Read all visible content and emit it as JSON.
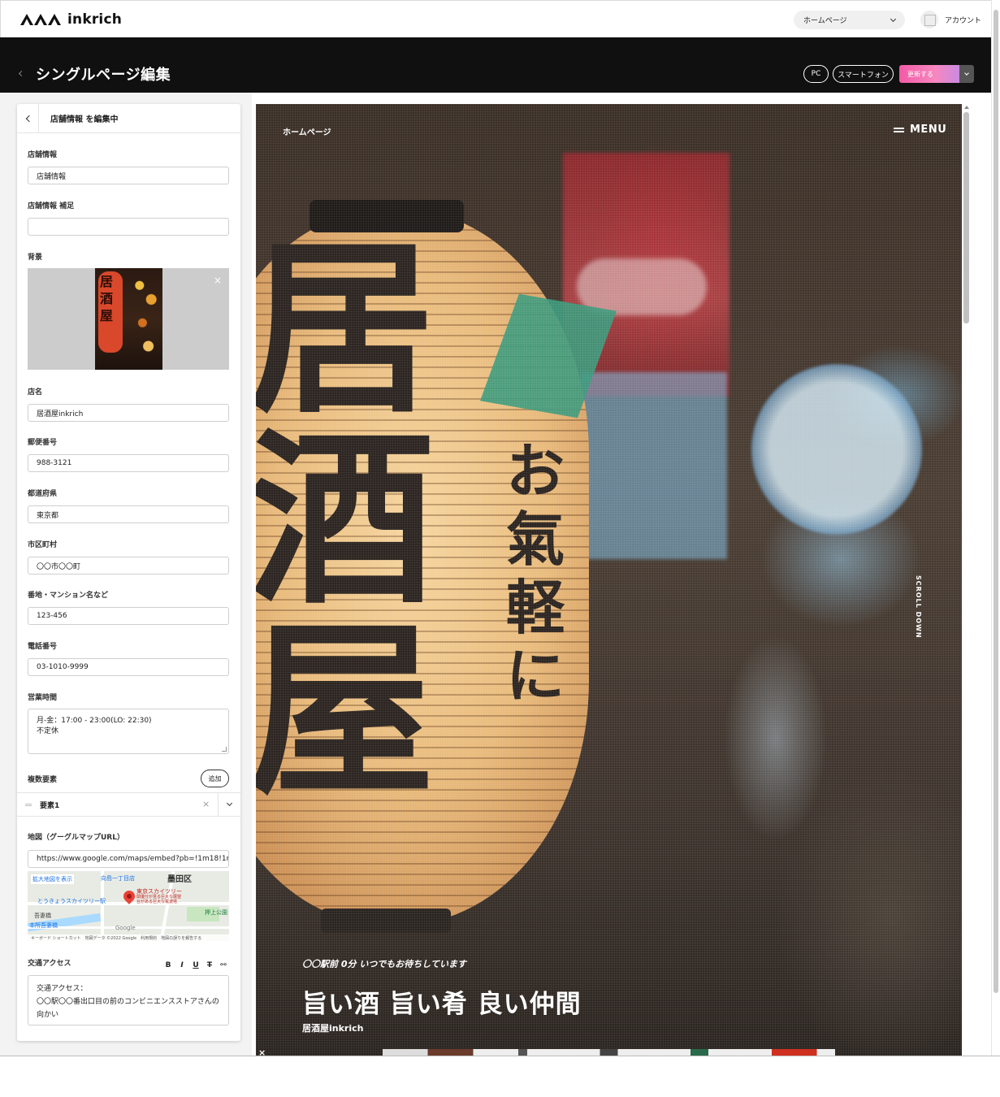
{
  "app": {
    "logo_text": "inkrich"
  },
  "topbar": {
    "page_select": "ホームページ",
    "account_label": "アカウント"
  },
  "titlebar": {
    "title": "シングルページ編集",
    "pc_label": "PC",
    "smartphone_label": "スマートフォン",
    "update_label": "更新する"
  },
  "panel": {
    "heading": "店舗情報 を編集中",
    "fields": {
      "store_info_label": "店舗情報",
      "store_info_value": "店舗情報",
      "store_info_sub_label": "店舗情報 補足",
      "store_info_sub_value": "",
      "background_label": "背景",
      "background_thumb_text": "居酒屋",
      "store_name_label": "店名",
      "store_name_value": "居酒屋inkrich",
      "postal_label": "郵便番号",
      "postal_value": "988-3121",
      "prefecture_label": "都道府県",
      "prefecture_value": "東京都",
      "city_label": "市区町村",
      "city_value": "〇〇市〇〇町",
      "address_label": "番地・マンション名など",
      "address_value": "123-456",
      "phone_label": "電話番号",
      "phone_value": "03-1010-9999",
      "hours_label": "営業時間",
      "hours_line1": "月-金：17:00 - 23:00(LO: 22:30)",
      "hours_line2": "不定休",
      "repeat_label": "複数要素",
      "add_label": "追加",
      "repeat_item": "要素1",
      "map_label": "地図（グーグルマップURL）",
      "map_url": "https://www.google.com/maps/embed?pb=!1m18!1m12!",
      "access_label": "交通アクセス",
      "access_line1": "交通アクセス：",
      "access_line2": "〇〇駅〇〇番出口目の前のコンビニエンスストアさんの向かい"
    },
    "map": {
      "enlarge": "拡大地図を表示",
      "station1": "向島一丁目店",
      "ward": "墨田区",
      "skytree": "東京スカイツリー",
      "skytree_sub1": "関優分が見る巨大な展望",
      "skytree_sub2": "台がある巨大な電波塔",
      "solamachi": "とうきょうスカイツリー駅",
      "azumabashi": "吾妻橋",
      "honjo": "本所吾妻橋",
      "oshiage": "押上公園",
      "google": "Google",
      "footer": "キーボード ショートカット　地図データ ©2022 Google　利用規約　地図の誤りを報告する"
    },
    "toolbar": {
      "bold": "B",
      "italic": "I",
      "underline": "U",
      "strike": "T",
      "link": "⚯"
    }
  },
  "preview": {
    "nav_home": "ホームページ",
    "menu": "MENU",
    "scroll_down": "SCROLL DOWN",
    "lantern_main": "居酒屋",
    "lantern_side": "お氣軽に",
    "subtitle": "〇〇駅前 0分 いつでもお待ちしています",
    "headline": "旨い酒 旨い肴 良い仲間",
    "store": "居酒屋inkrich",
    "ad_close": "×"
  }
}
